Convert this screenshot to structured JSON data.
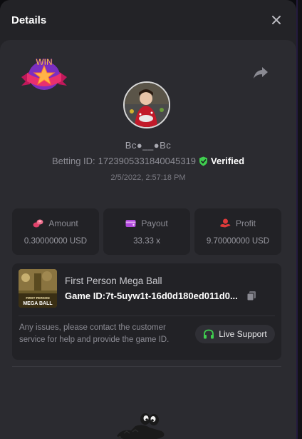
{
  "header": {
    "title": "Details"
  },
  "player": {
    "username": "Bc●__●Bc",
    "betting_id_label": "Betting ID:",
    "betting_id": "1723905331840045319",
    "verified_label": "Verified",
    "datetime": "2/5/2022, 2:57:18 PM",
    "win_badge_text": "WIN"
  },
  "stats": [
    {
      "label": "Amount",
      "value": "0.30000000 USD",
      "icon": "coins-icon",
      "icon_color": "#e0416a"
    },
    {
      "label": "Payout",
      "value": "33.33 x",
      "icon": "wallet-icon",
      "icon_color": "#b04adb"
    },
    {
      "label": "Profit",
      "value": "9.70000000 USD",
      "icon": "money-hand-icon",
      "icon_color": "#e03a3a"
    }
  ],
  "game": {
    "name": "First Person Mega Ball",
    "id_label": "Game ID:",
    "id": "7t-5uyw1t-16d0d180ed011d0...",
    "thumb_text": "FIRST PERSON MEGA BALL"
  },
  "support": {
    "note": "Any issues, please contact the customer service for help and provide the game ID.",
    "button_label": "Live Support",
    "icon_color": "#3fcf4f"
  },
  "colors": {
    "verified": "#3fcf4f",
    "accent_purple": "#3b2a6e"
  }
}
